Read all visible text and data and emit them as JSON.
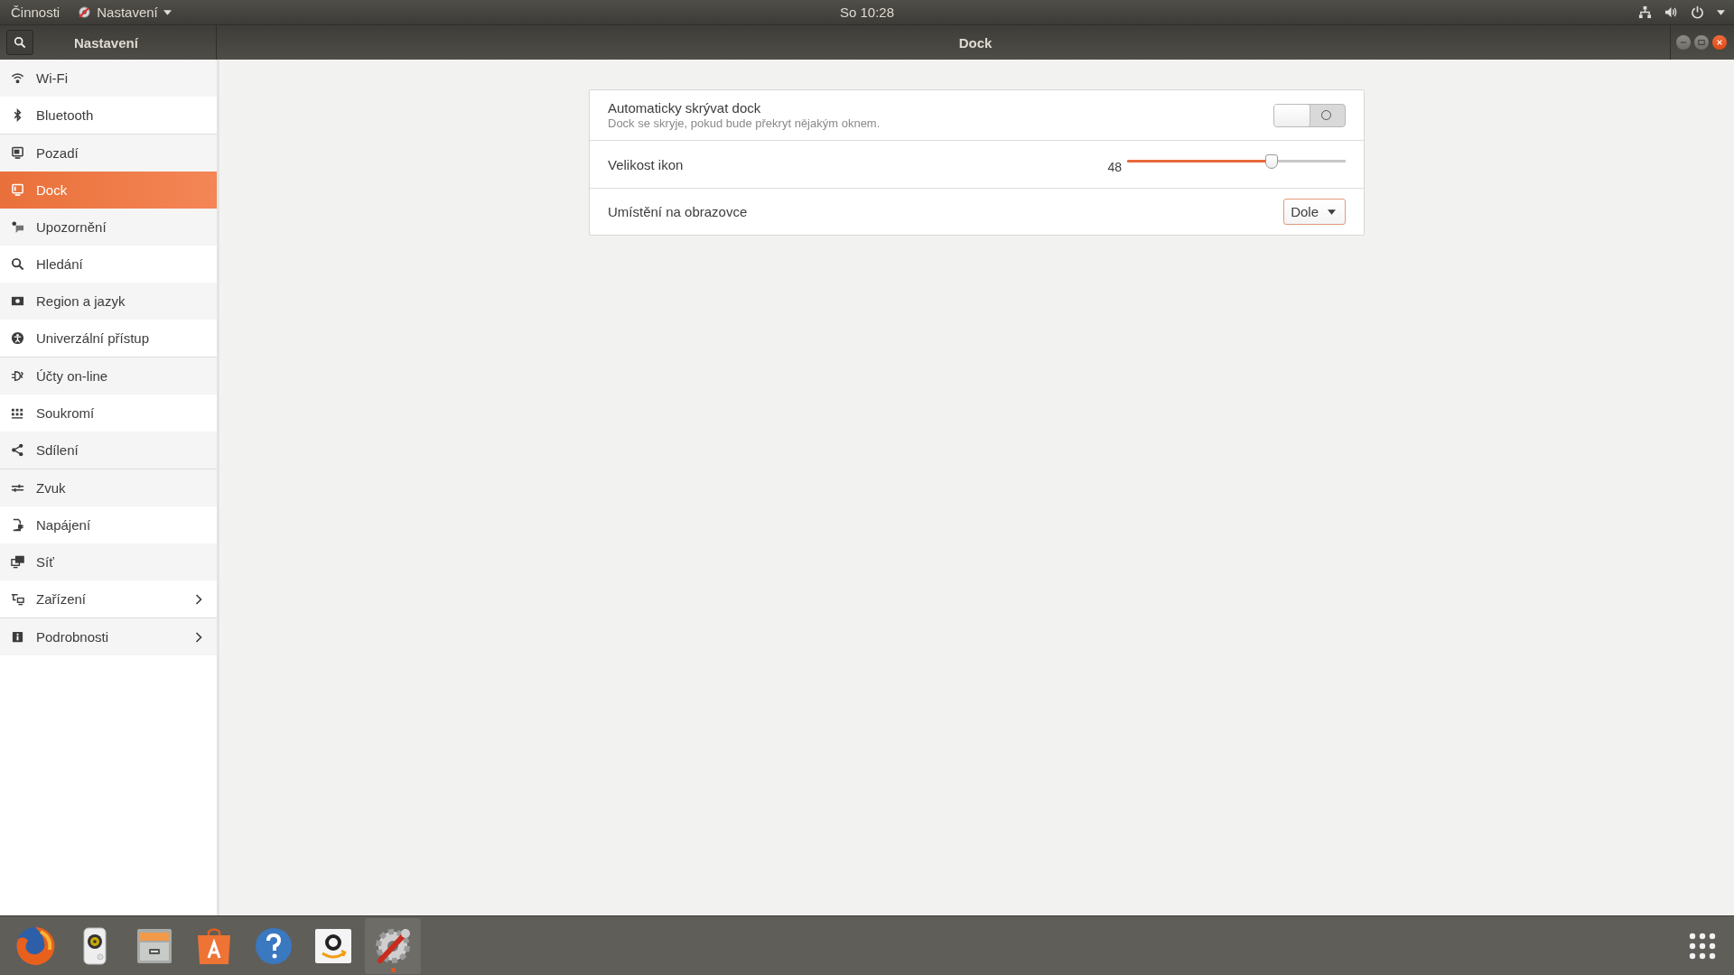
{
  "top_bar": {
    "activities": "Činnosti",
    "app_menu": "Nastavení",
    "clock": "So 10:28"
  },
  "header": {
    "sidebar_title": "Nastavení",
    "title": "Dock"
  },
  "sidebar": {
    "groups": [
      {
        "items": [
          {
            "kind": "wifi",
            "label": "Wi-Fi",
            "selected": false,
            "submenu": false
          },
          {
            "kind": "bluetooth",
            "label": "Bluetooth",
            "selected": false,
            "submenu": false
          }
        ]
      },
      {
        "items": [
          {
            "kind": "monitor",
            "label": "Pozadí",
            "selected": false,
            "submenu": false
          },
          {
            "kind": "dock",
            "label": "Dock",
            "selected": true,
            "submenu": false
          },
          {
            "kind": "chat",
            "label": "Upozornění",
            "selected": false,
            "submenu": false
          },
          {
            "kind": "search",
            "label": "Hledání",
            "selected": false,
            "submenu": false
          },
          {
            "kind": "flag",
            "label": "Region a jazyk",
            "selected": false,
            "submenu": false
          },
          {
            "kind": "person",
            "label": "Univerzální přístup",
            "selected": false,
            "submenu": false
          }
        ]
      },
      {
        "items": [
          {
            "kind": "accounts",
            "label": "Účty on-line",
            "selected": false,
            "submenu": false
          },
          {
            "kind": "grid",
            "label": "Soukromí",
            "selected": false,
            "submenu": false
          },
          {
            "kind": "share",
            "label": "Sdílení",
            "selected": false,
            "submenu": false
          }
        ]
      },
      {
        "items": [
          {
            "kind": "sliders",
            "label": "Zvuk",
            "selected": false,
            "submenu": false
          },
          {
            "kind": "plug",
            "label": "Napájení",
            "selected": false,
            "submenu": false
          },
          {
            "kind": "network",
            "label": "Síť",
            "selected": false,
            "submenu": false
          },
          {
            "kind": "devices",
            "label": "Zařízení",
            "selected": false,
            "submenu": true
          }
        ]
      },
      {
        "items": [
          {
            "kind": "info",
            "label": "Podrobnosti",
            "selected": false,
            "submenu": true
          }
        ]
      }
    ]
  },
  "settings": [
    {
      "kind": "toggle",
      "label": "Automaticky skrývat dock",
      "description": "Dock se skryje, pokud bude překryt nějakým oknem.",
      "on": false
    },
    {
      "kind": "slider",
      "label": "Velikost ikon",
      "reading": "48",
      "level": 0.66
    },
    {
      "kind": "dropdown",
      "label": "Umístění na obrazovce",
      "value": "Dole"
    }
  ],
  "dock": {
    "launchers": [
      {
        "kind": "firefox",
        "running": false
      },
      {
        "kind": "speaker",
        "running": false
      },
      {
        "kind": "files",
        "running": false
      },
      {
        "kind": "software",
        "running": false
      },
      {
        "kind": "help",
        "running": false
      },
      {
        "kind": "amazon",
        "running": false
      },
      {
        "kind": "settings",
        "running": true
      }
    ]
  }
}
